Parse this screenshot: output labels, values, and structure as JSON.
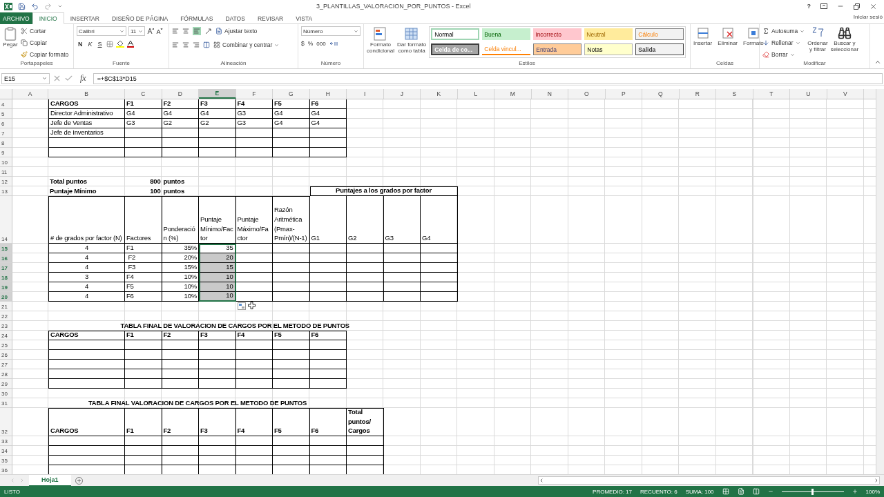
{
  "window": {
    "title": "3_PLANTILLAS_VALORACION_POR_PUNTOS - Excel",
    "help": "?",
    "sign_in": "Iniciar sesió"
  },
  "tabs": [
    {
      "label": "ARCHIVO",
      "kind": "file",
      "selected": false
    },
    {
      "label": "INICIO",
      "kind": "tab",
      "selected": true
    },
    {
      "label": "INSERTAR",
      "kind": "tab",
      "selected": false
    },
    {
      "label": "DISEÑO DE PÁGINA",
      "kind": "tab",
      "selected": false
    },
    {
      "label": "FÓRMULAS",
      "kind": "tab",
      "selected": false
    },
    {
      "label": "DATOS",
      "kind": "tab",
      "selected": false
    },
    {
      "label": "REVISAR",
      "kind": "tab",
      "selected": false
    },
    {
      "label": "VISTA",
      "kind": "tab",
      "selected": false
    }
  ],
  "ribbon": {
    "clipboard": {
      "label": "Portapapeles",
      "paste": "Pegar",
      "cut": "Cortar",
      "copy": "Copiar",
      "format_painter": "Copiar formato"
    },
    "font": {
      "label": "Fuente",
      "font_name": "Calibri",
      "font_size": "11",
      "bold": "N",
      "italic": "K",
      "underline": "S"
    },
    "alignment": {
      "label": "Alineación",
      "wrap_text": "Ajustar texto",
      "merge": "Combinar y centrar"
    },
    "number": {
      "label": "Número",
      "format": "Número",
      "currency": "$",
      "percent": "%",
      "thousands": "000"
    },
    "styles": {
      "label": "Estilos",
      "conditional": [
        "Formato",
        "condicional"
      ],
      "as_table": [
        "Dar formato",
        "como tabla"
      ],
      "chips": [
        {
          "label": "Normal",
          "kind": "normal"
        },
        {
          "label": "Buena",
          "kind": "good"
        },
        {
          "label": "Incorrecto",
          "kind": "bad"
        },
        {
          "label": "Neutral",
          "kind": "neutral"
        },
        {
          "label": "Cálculo",
          "kind": "calc"
        },
        {
          "label": "Celda de co...",
          "kind": "check"
        },
        {
          "label": "Celda vincul...",
          "kind": "linked"
        },
        {
          "label": "Entrada",
          "kind": "input"
        },
        {
          "label": "Notas",
          "kind": "note"
        },
        {
          "label": "Salida",
          "kind": "output"
        }
      ]
    },
    "cells": {
      "label": "Celdas",
      "insert": "Insertar",
      "delete": "Eliminar",
      "format": "Formato"
    },
    "editing": {
      "label": "Modificar",
      "autosum": "Autosuma",
      "fill": "Rellenar",
      "clear": "Borrar",
      "sort": [
        "Ordenar",
        "y filtrar"
      ],
      "find": [
        "Buscar y",
        "seleccionar"
      ]
    }
  },
  "formula_bar": {
    "name_box": "E15",
    "fx": "fx",
    "formula": "=+$C$13*D15"
  },
  "columns": [
    {
      "letter": "A",
      "selected": false
    },
    {
      "letter": "B",
      "selected": false
    },
    {
      "letter": "C",
      "selected": false
    },
    {
      "letter": "D",
      "selected": false
    },
    {
      "letter": "E",
      "selected": true
    },
    {
      "letter": "F",
      "selected": false
    },
    {
      "letter": "G",
      "selected": false
    },
    {
      "letter": "H",
      "selected": false
    },
    {
      "letter": "I",
      "selected": false
    },
    {
      "letter": "J",
      "selected": false
    },
    {
      "letter": "K",
      "selected": false
    },
    {
      "letter": "L",
      "selected": false
    },
    {
      "letter": "M",
      "selected": false
    },
    {
      "letter": "N",
      "selected": false
    },
    {
      "letter": "O",
      "selected": false
    },
    {
      "letter": "P",
      "selected": false
    },
    {
      "letter": "Q",
      "selected": false
    },
    {
      "letter": "R",
      "selected": false
    },
    {
      "letter": "S",
      "selected": false
    },
    {
      "letter": "T",
      "selected": false
    },
    {
      "letter": "U",
      "selected": false
    },
    {
      "letter": "V",
      "selected": false
    }
  ],
  "rows": [
    {
      "number": "4",
      "selected": false,
      "cells": [
        null,
        {
          "text": "CARGOS",
          "bold": true,
          "selected": false
        },
        {
          "text": "F1",
          "bold": true,
          "selected": false
        },
        {
          "text": "F2",
          "bold": true,
          "selected": false
        },
        {
          "text": "F3",
          "bold": true,
          "selected": false
        },
        {
          "text": "F4",
          "bold": true,
          "selected": false
        },
        {
          "text": "F5",
          "bold": true,
          "selected": false
        },
        {
          "text": "F6",
          "bold": true,
          "selected": false
        }
      ]
    },
    {
      "number": "5",
      "selected": false,
      "cells": [
        null,
        {
          "text": "Director Administrativo",
          "bold": false,
          "selected": false
        },
        {
          "text": "G4",
          "bold": false,
          "selected": false
        },
        {
          "text": "G4",
          "bold": false,
          "selected": false
        },
        {
          "text": "G4",
          "bold": false,
          "selected": false
        },
        {
          "text": "G3",
          "bold": false,
          "selected": false
        },
        {
          "text": "G4",
          "bold": false,
          "selected": false
        },
        {
          "text": "G4",
          "bold": false,
          "selected": false
        }
      ]
    },
    {
      "number": "6",
      "selected": false,
      "cells": [
        null,
        {
          "text": "Jefe de Ventas",
          "bold": false,
          "selected": false
        },
        {
          "text": "G3",
          "bold": false,
          "selected": false
        },
        {
          "text": "G2",
          "bold": false,
          "selected": false
        },
        {
          "text": "G2",
          "bold": false,
          "selected": false
        },
        {
          "text": "G3",
          "bold": false,
          "selected": false
        },
        {
          "text": "G4",
          "bold": false,
          "selected": false
        },
        {
          "text": "G4",
          "bold": false,
          "selected": false
        }
      ]
    },
    {
      "number": "7",
      "selected": false,
      "cells": [
        null,
        {
          "text": "Jefe de Inventarios",
          "bold": false,
          "selected": false
        }
      ]
    },
    {
      "number": "8",
      "selected": false
    },
    {
      "number": "9",
      "selected": false
    },
    {
      "number": "10",
      "selected": false
    },
    {
      "number": "11",
      "selected": false
    },
    {
      "number": "12",
      "selected": false,
      "cells": [
        null,
        {
          "text": "Total puntos",
          "bold": true,
          "selected": false
        },
        {
          "text": "800",
          "bold": true,
          "selected": false
        },
        {
          "text": "puntos",
          "bold": true,
          "selected": false
        }
      ]
    },
    {
      "number": "13",
      "selected": false,
      "cells": [
        null,
        {
          "text": "Puntaje Mínimo",
          "bold": true,
          "selected": false
        },
        {
          "text": "100",
          "bold": true,
          "selected": false
        },
        {
          "text": "puntos",
          "bold": true,
          "selected": false
        },
        null,
        null,
        null,
        {
          "text": "Puntajes a los grados por factor",
          "bold": true,
          "selected": false
        }
      ]
    },
    {
      "number": "14",
      "selected": false,
      "cells": [
        null,
        {
          "lines": [
            "# de grados por factor (N)"
          ],
          "bold": false,
          "selected": false
        },
        {
          "lines": [
            "Factores"
          ],
          "bold": false,
          "selected": false
        },
        {
          "lines": [
            "Ponderació",
            "n (%)"
          ],
          "bold": false,
          "selected": false
        },
        {
          "lines": [
            "Puntaje",
            "Mínimo/Fac",
            "tor"
          ],
          "bold": false,
          "selected": false
        },
        {
          "lines": [
            "Puntaje",
            "Máximo/Fa",
            "ctor"
          ],
          "bold": false,
          "selected": false
        },
        {
          "lines": [
            "Razón",
            "Aritmética",
            "(Pmax-",
            "Pmín)/(N-1)"
          ],
          "bold": false,
          "selected": false
        },
        {
          "lines": [
            "G1"
          ],
          "bold": false,
          "selected": false
        },
        {
          "lines": [
            "G2"
          ],
          "bold": false,
          "selected": false
        },
        {
          "lines": [
            "G3"
          ],
          "bold": false,
          "selected": false
        },
        {
          "lines": [
            "G4"
          ],
          "bold": false,
          "selected": false
        }
      ]
    },
    {
      "number": "15",
      "selected": true,
      "cells": [
        null,
        {
          "text": "4",
          "bold": false,
          "selected": false
        },
        {
          "text": "F1",
          "bold": false,
          "selected": false
        },
        {
          "text": "35%",
          "bold": false,
          "selected": false
        },
        {
          "text": "35",
          "bold": false,
          "selected": true,
          "active": true
        }
      ]
    },
    {
      "number": "16",
      "selected": true,
      "cells": [
        null,
        {
          "text": "4",
          "bold": false,
          "selected": false
        },
        {
          "text": " F2",
          "bold": false,
          "selected": false
        },
        {
          "text": "20%",
          "bold": false,
          "selected": false
        },
        {
          "text": "20",
          "bold": false,
          "selected": true,
          "active": false
        }
      ]
    },
    {
      "number": "17",
      "selected": true,
      "cells": [
        null,
        {
          "text": "4",
          "bold": false,
          "selected": false
        },
        {
          "text": " F3",
          "bold": false,
          "selected": false
        },
        {
          "text": "15%",
          "bold": false,
          "selected": false
        },
        {
          "text": "15",
          "bold": false,
          "selected": true,
          "active": false
        }
      ]
    },
    {
      "number": "18",
      "selected": true,
      "cells": [
        null,
        {
          "text": "3",
          "bold": false,
          "selected": false
        },
        {
          "text": "F4",
          "bold": false,
          "selected": false
        },
        {
          "text": "10%",
          "bold": false,
          "selected": false
        },
        {
          "text": "10",
          "bold": false,
          "selected": true,
          "active": false
        }
      ]
    },
    {
      "number": "19",
      "selected": true,
      "cells": [
        null,
        {
          "text": "4",
          "bold": false,
          "selected": false
        },
        {
          "text": "F5",
          "bold": false,
          "selected": false
        },
        {
          "text": "10%",
          "bold": false,
          "selected": false
        },
        {
          "text": "10",
          "bold": false,
          "selected": true,
          "active": false
        }
      ]
    },
    {
      "number": "20",
      "selected": true,
      "cells": [
        null,
        {
          "text": "4",
          "bold": false,
          "selected": false
        },
        {
          "text": "F6",
          "bold": false,
          "selected": false
        },
        {
          "text": "10%",
          "bold": false,
          "selected": false
        },
        {
          "text": "10",
          "bold": false,
          "selected": true,
          "active": false
        }
      ]
    },
    {
      "number": "21",
      "selected": false
    },
    {
      "number": "22",
      "selected": false
    },
    {
      "number": "23",
      "selected": false,
      "cells": [
        {
          "text": "TABLA FINAL DE VALORACION DE CARGOS POR EL METODO DE PUNTOS",
          "bold": true,
          "selected": false
        }
      ]
    },
    {
      "number": "24",
      "selected": false,
      "cells": [
        null,
        {
          "text": "CARGOS",
          "bold": true,
          "selected": false
        },
        {
          "text": "F1",
          "bold": true,
          "selected": false
        },
        {
          "text": "F2",
          "bold": true,
          "selected": false
        },
        {
          "text": "F3",
          "bold": true,
          "selected": false
        },
        {
          "text": "F4",
          "bold": true,
          "selected": false
        },
        {
          "text": "F5",
          "bold": true,
          "selected": false
        },
        {
          "text": "F6",
          "bold": true,
          "selected": false
        }
      ]
    },
    {
      "number": "25",
      "selected": false
    },
    {
      "number": "26",
      "selected": false
    },
    {
      "number": "27",
      "selected": false
    },
    {
      "number": "28",
      "selected": false
    },
    {
      "number": "29",
      "selected": false
    },
    {
      "number": "30",
      "selected": false
    },
    {
      "number": "31",
      "selected": false,
      "cells": [
        null,
        {
          "text": "TABLA FINAL VALORACION DE CARGOS POR EL METODO DE PUNTOS",
          "bold": true,
          "selected": false
        }
      ]
    },
    {
      "number": "32",
      "selected": false,
      "cells": [
        null,
        {
          "lines": [
            "CARGOS"
          ],
          "bold": true,
          "selected": false
        },
        {
          "lines": [
            "F1"
          ],
          "bold": true,
          "selected": false
        },
        {
          "lines": [
            "F2"
          ],
          "bold": true,
          "selected": false
        },
        {
          "lines": [
            "F3"
          ],
          "bold": true,
          "selected": false
        },
        {
          "lines": [
            "F4"
          ],
          "bold": true,
          "selected": false
        },
        {
          "lines": [
            "F5"
          ],
          "bold": true,
          "selected": false
        },
        {
          "lines": [
            "F6"
          ],
          "bold": true,
          "selected": false
        },
        {
          "lines": [
            "Total",
            "puntos/",
            "Cargos"
          ],
          "bold": true,
          "selected": false
        }
      ]
    },
    {
      "number": "33",
      "selected": false
    },
    {
      "number": "34",
      "selected": false
    },
    {
      "number": "35",
      "selected": false
    },
    {
      "number": "36",
      "selected": false
    }
  ],
  "sheet_tabs": [
    {
      "label": "Hoja1",
      "selected": true
    }
  ],
  "status_bar": {
    "mode": "LISTO",
    "stats": [
      "PROMEDIO: 17",
      "RECUENTO: 6",
      "SUMA: 100"
    ],
    "zoom": {
      "level": 0.5,
      "reading": "100%"
    }
  }
}
